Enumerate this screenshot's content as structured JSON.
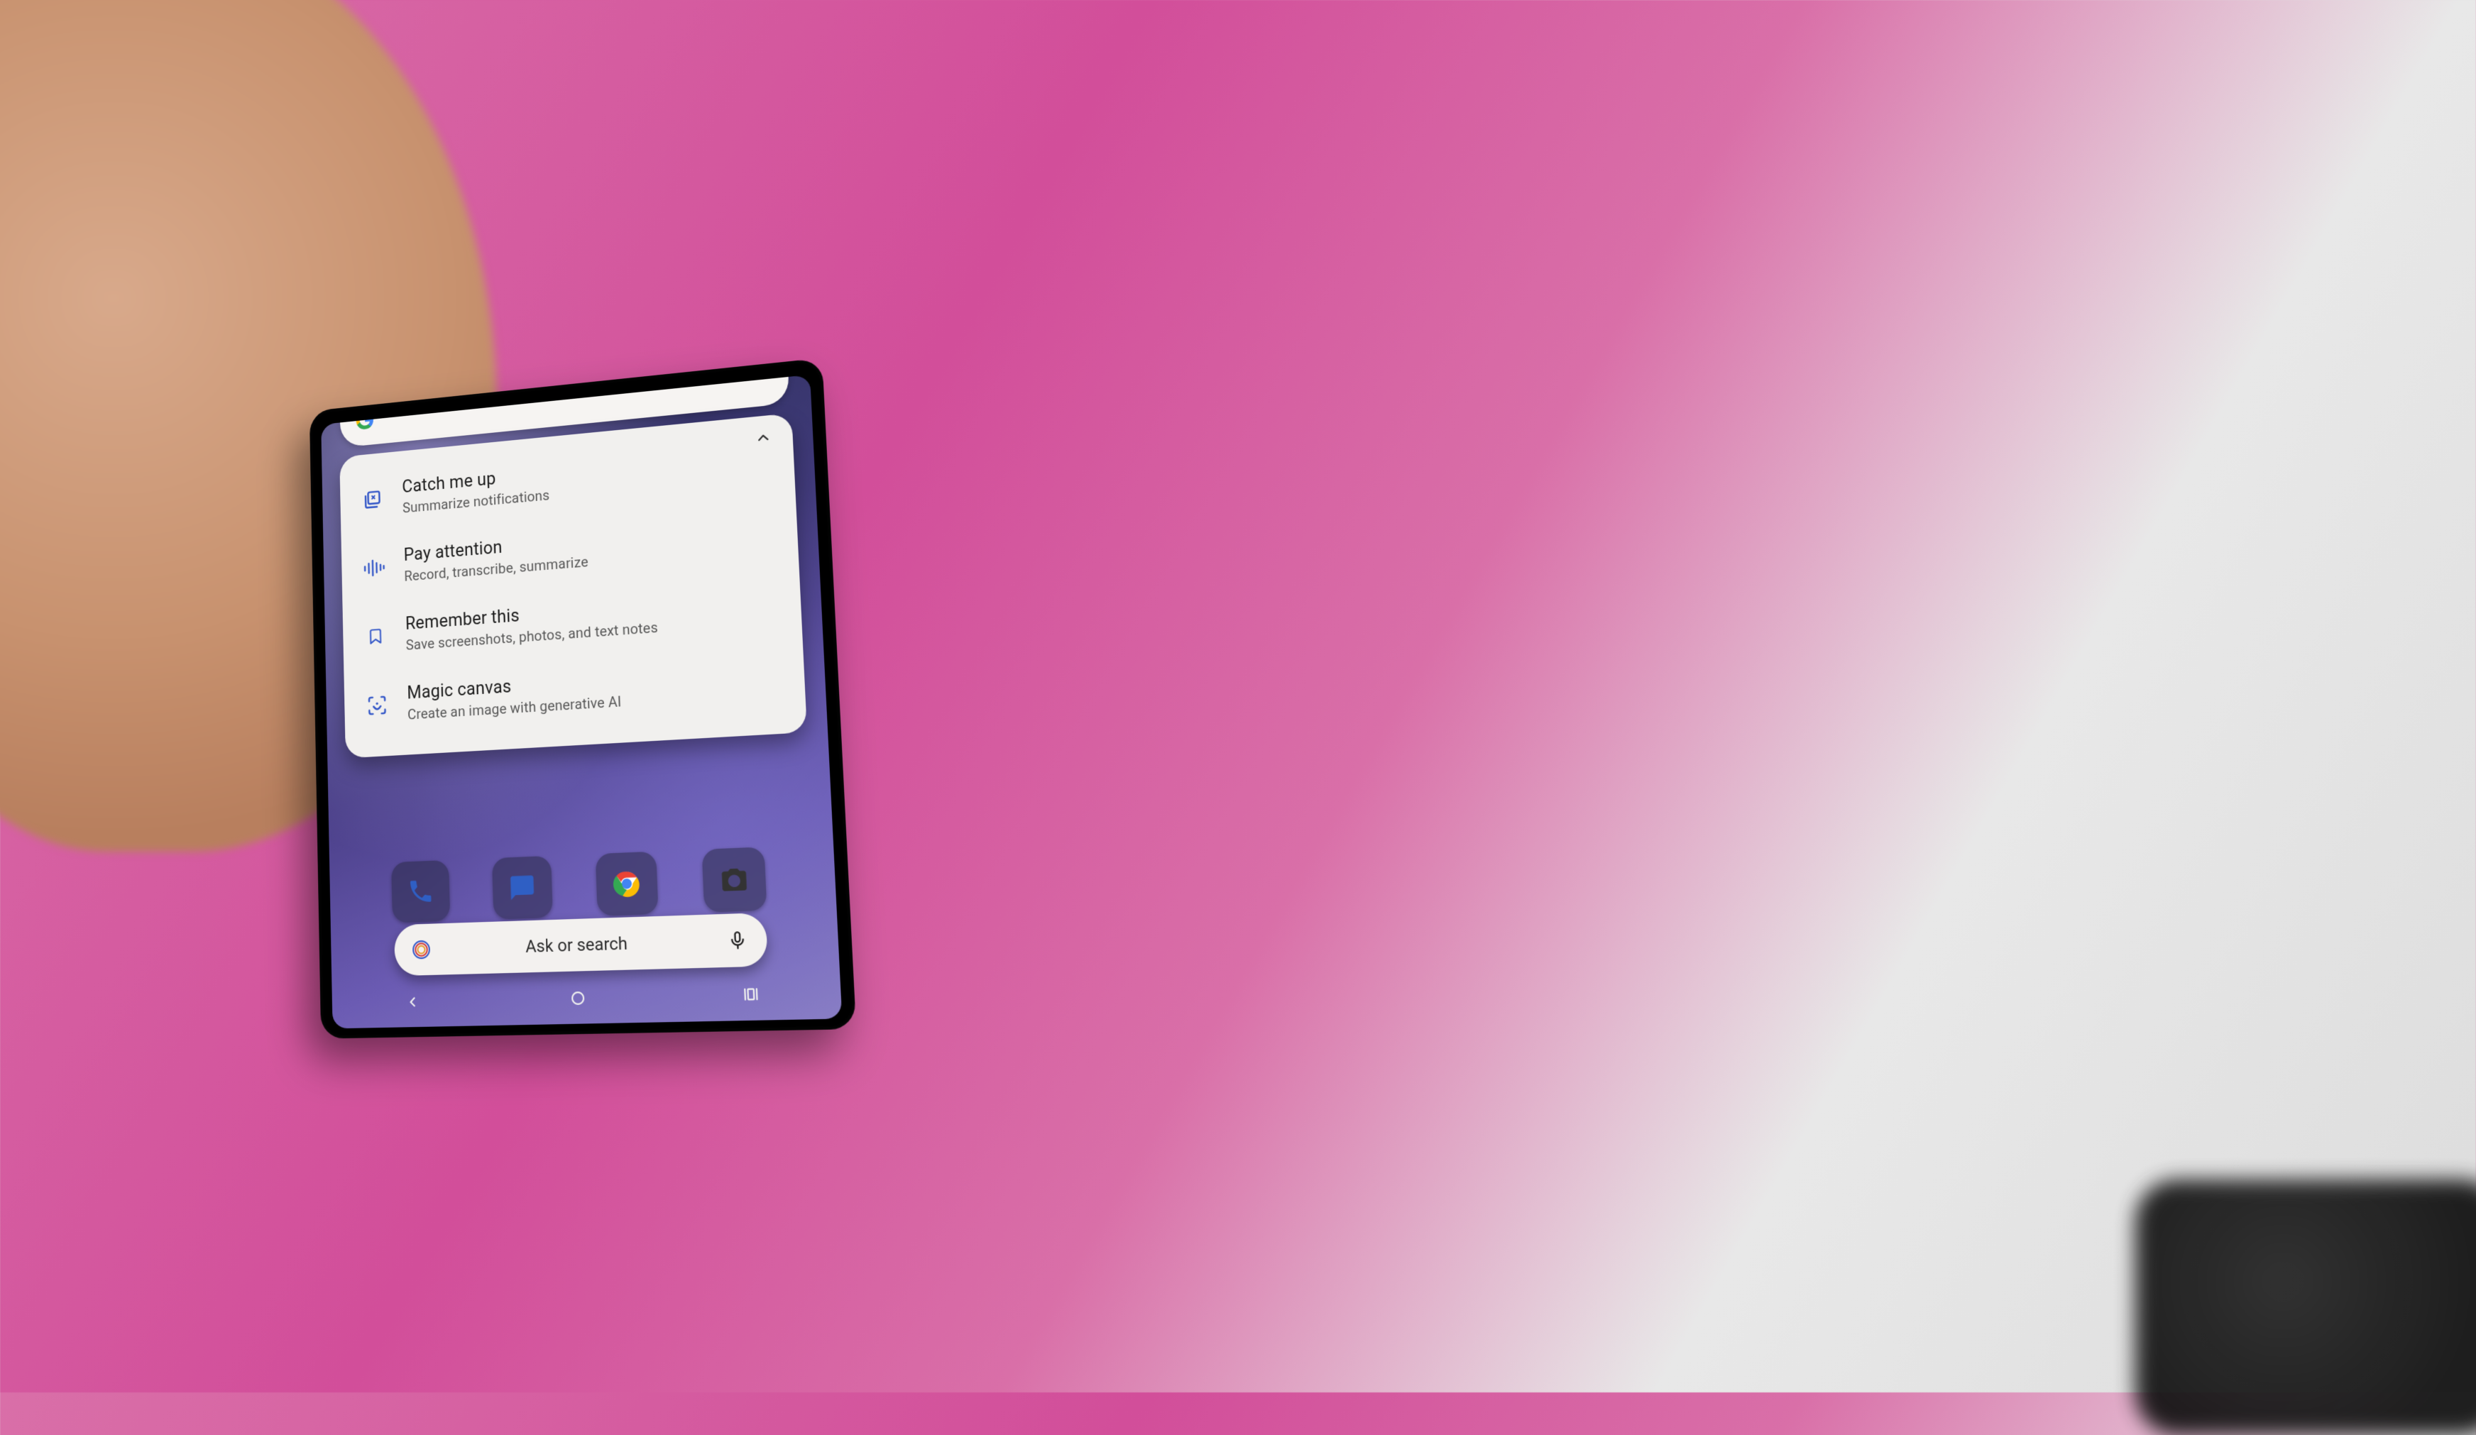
{
  "card": {
    "items": [
      {
        "icon": "catch-up-icon",
        "title": "Catch me up",
        "sub": "Summarize notifications"
      },
      {
        "icon": "waveform-icon",
        "title": "Pay attention",
        "sub": "Record, transcribe, summarize"
      },
      {
        "icon": "bookmark-icon",
        "title": "Remember this",
        "sub": "Save screenshots, photos, and text notes"
      },
      {
        "icon": "magic-scan-icon",
        "title": "Magic canvas",
        "sub": "Create an image with generative AI"
      }
    ]
  },
  "ask_bar": {
    "placeholder": "Ask or search"
  },
  "colors": {
    "card_bg": "#f1f0ee",
    "icon_accent": "#3659c8",
    "title_text": "#1c1c1c",
    "sub_text": "#575757"
  }
}
